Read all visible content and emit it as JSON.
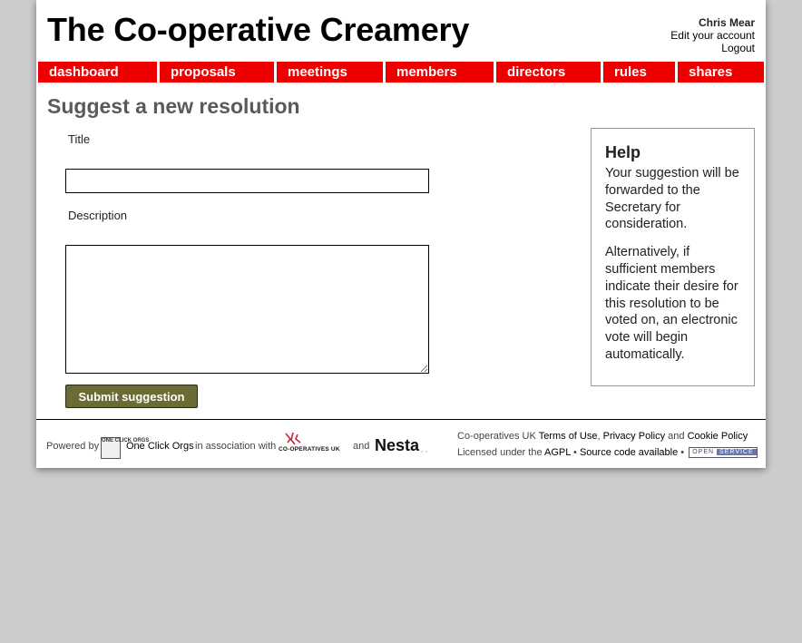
{
  "site": {
    "title": "The Co-operative Creamery"
  },
  "user": {
    "name": "Chris Mear",
    "edit_account": "Edit your account",
    "logout": "Logout"
  },
  "nav": {
    "items": [
      {
        "label": "dashboard"
      },
      {
        "label": "proposals"
      },
      {
        "label": "meetings"
      },
      {
        "label": "members"
      },
      {
        "label": "directors"
      },
      {
        "label": "rules"
      },
      {
        "label": "shares"
      }
    ],
    "color": "#ee0000"
  },
  "main": {
    "heading": "Suggest a new resolution",
    "title_label": "Title",
    "title_value": "",
    "description_label": "Description",
    "description_value": "",
    "submit_label": "Submit suggestion"
  },
  "help": {
    "title": "Help",
    "paragraphs": [
      "Your suggestion will be forwarded to the Secretary for consideration.",
      "Alternatively, if sufficient members indicate their desire for this resolution to be voted on, an electronic vote will begin automatically."
    ]
  },
  "footer": {
    "powered_by": "Powered by",
    "oco_logo_text": "ONE CLICK ORGS",
    "oco_name": "One Click Orgs",
    "in_association": "in association with",
    "coops_logo_text": "CO-OPERATIVES UK",
    "and": "and",
    "nesta": "Nesta",
    "coops_uk": "Co-operatives UK",
    "terms": "Terms of Use",
    "comma": ",",
    "privacy": "Privacy Policy",
    "and2": "and",
    "cookie": "Cookie Policy",
    "licensed": "Licensed under the",
    "agpl": "AGPL",
    "bullet": "•",
    "source": "Source code available",
    "open_a": "OPEN",
    "open_b": "SERVICE"
  },
  "colors": {
    "background": "#cccccc",
    "button": "#6b6b35",
    "heading": "#5a5a5a"
  }
}
